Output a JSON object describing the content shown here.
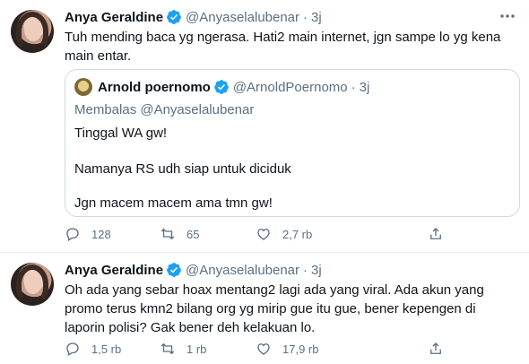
{
  "tweets": [
    {
      "author_name": "Anya Geraldine",
      "author_handle": "@Anyaselalubenar",
      "separator": "·",
      "time": "3j",
      "text": "Tuh mending baca yg ngerasa. Hati2 main internet, jgn sampe lo yg kena\nmain entar.",
      "quote": {
        "author_name": "Arnold poernomo",
        "author_handle": "@ArnoldPoernomo",
        "separator": "·",
        "time": "3j",
        "reply_to": "Membalas @Anyaselalubenar",
        "lines": [
          "Tinggal WA gw!",
          "Namanya RS udh siap untuk diciduk",
          "Jgn macem macem ama tmn gw!"
        ]
      },
      "counts": {
        "replies": "128",
        "retweets": "65",
        "likes": "2,7 rb"
      }
    },
    {
      "author_name": "Anya Geraldine",
      "author_handle": "@Anyaselalubenar",
      "separator": "·",
      "time": "3j",
      "text": "Oh ada yang sebar hoax mentang2 lagi ada yang viral. Ada akun yang\npromo terus kmn2 bilang org yg mirip gue itu gue, bener kepengen di\nlaporin polisi? Gak bener deh kelakuan lo.",
      "counts": {
        "replies": "1,5 rb",
        "retweets": "1 rb",
        "likes": "17,9 rb"
      }
    }
  ],
  "icons": {
    "verified": "verified-badge-icon",
    "more": "more-options-icon",
    "reply": "reply-icon",
    "retweet": "retweet-icon",
    "like": "heart-icon",
    "share": "share-icon"
  },
  "colors": {
    "verified": "#1da1f2",
    "secondary_text": "#5b7083",
    "border": "#cfd9de"
  }
}
